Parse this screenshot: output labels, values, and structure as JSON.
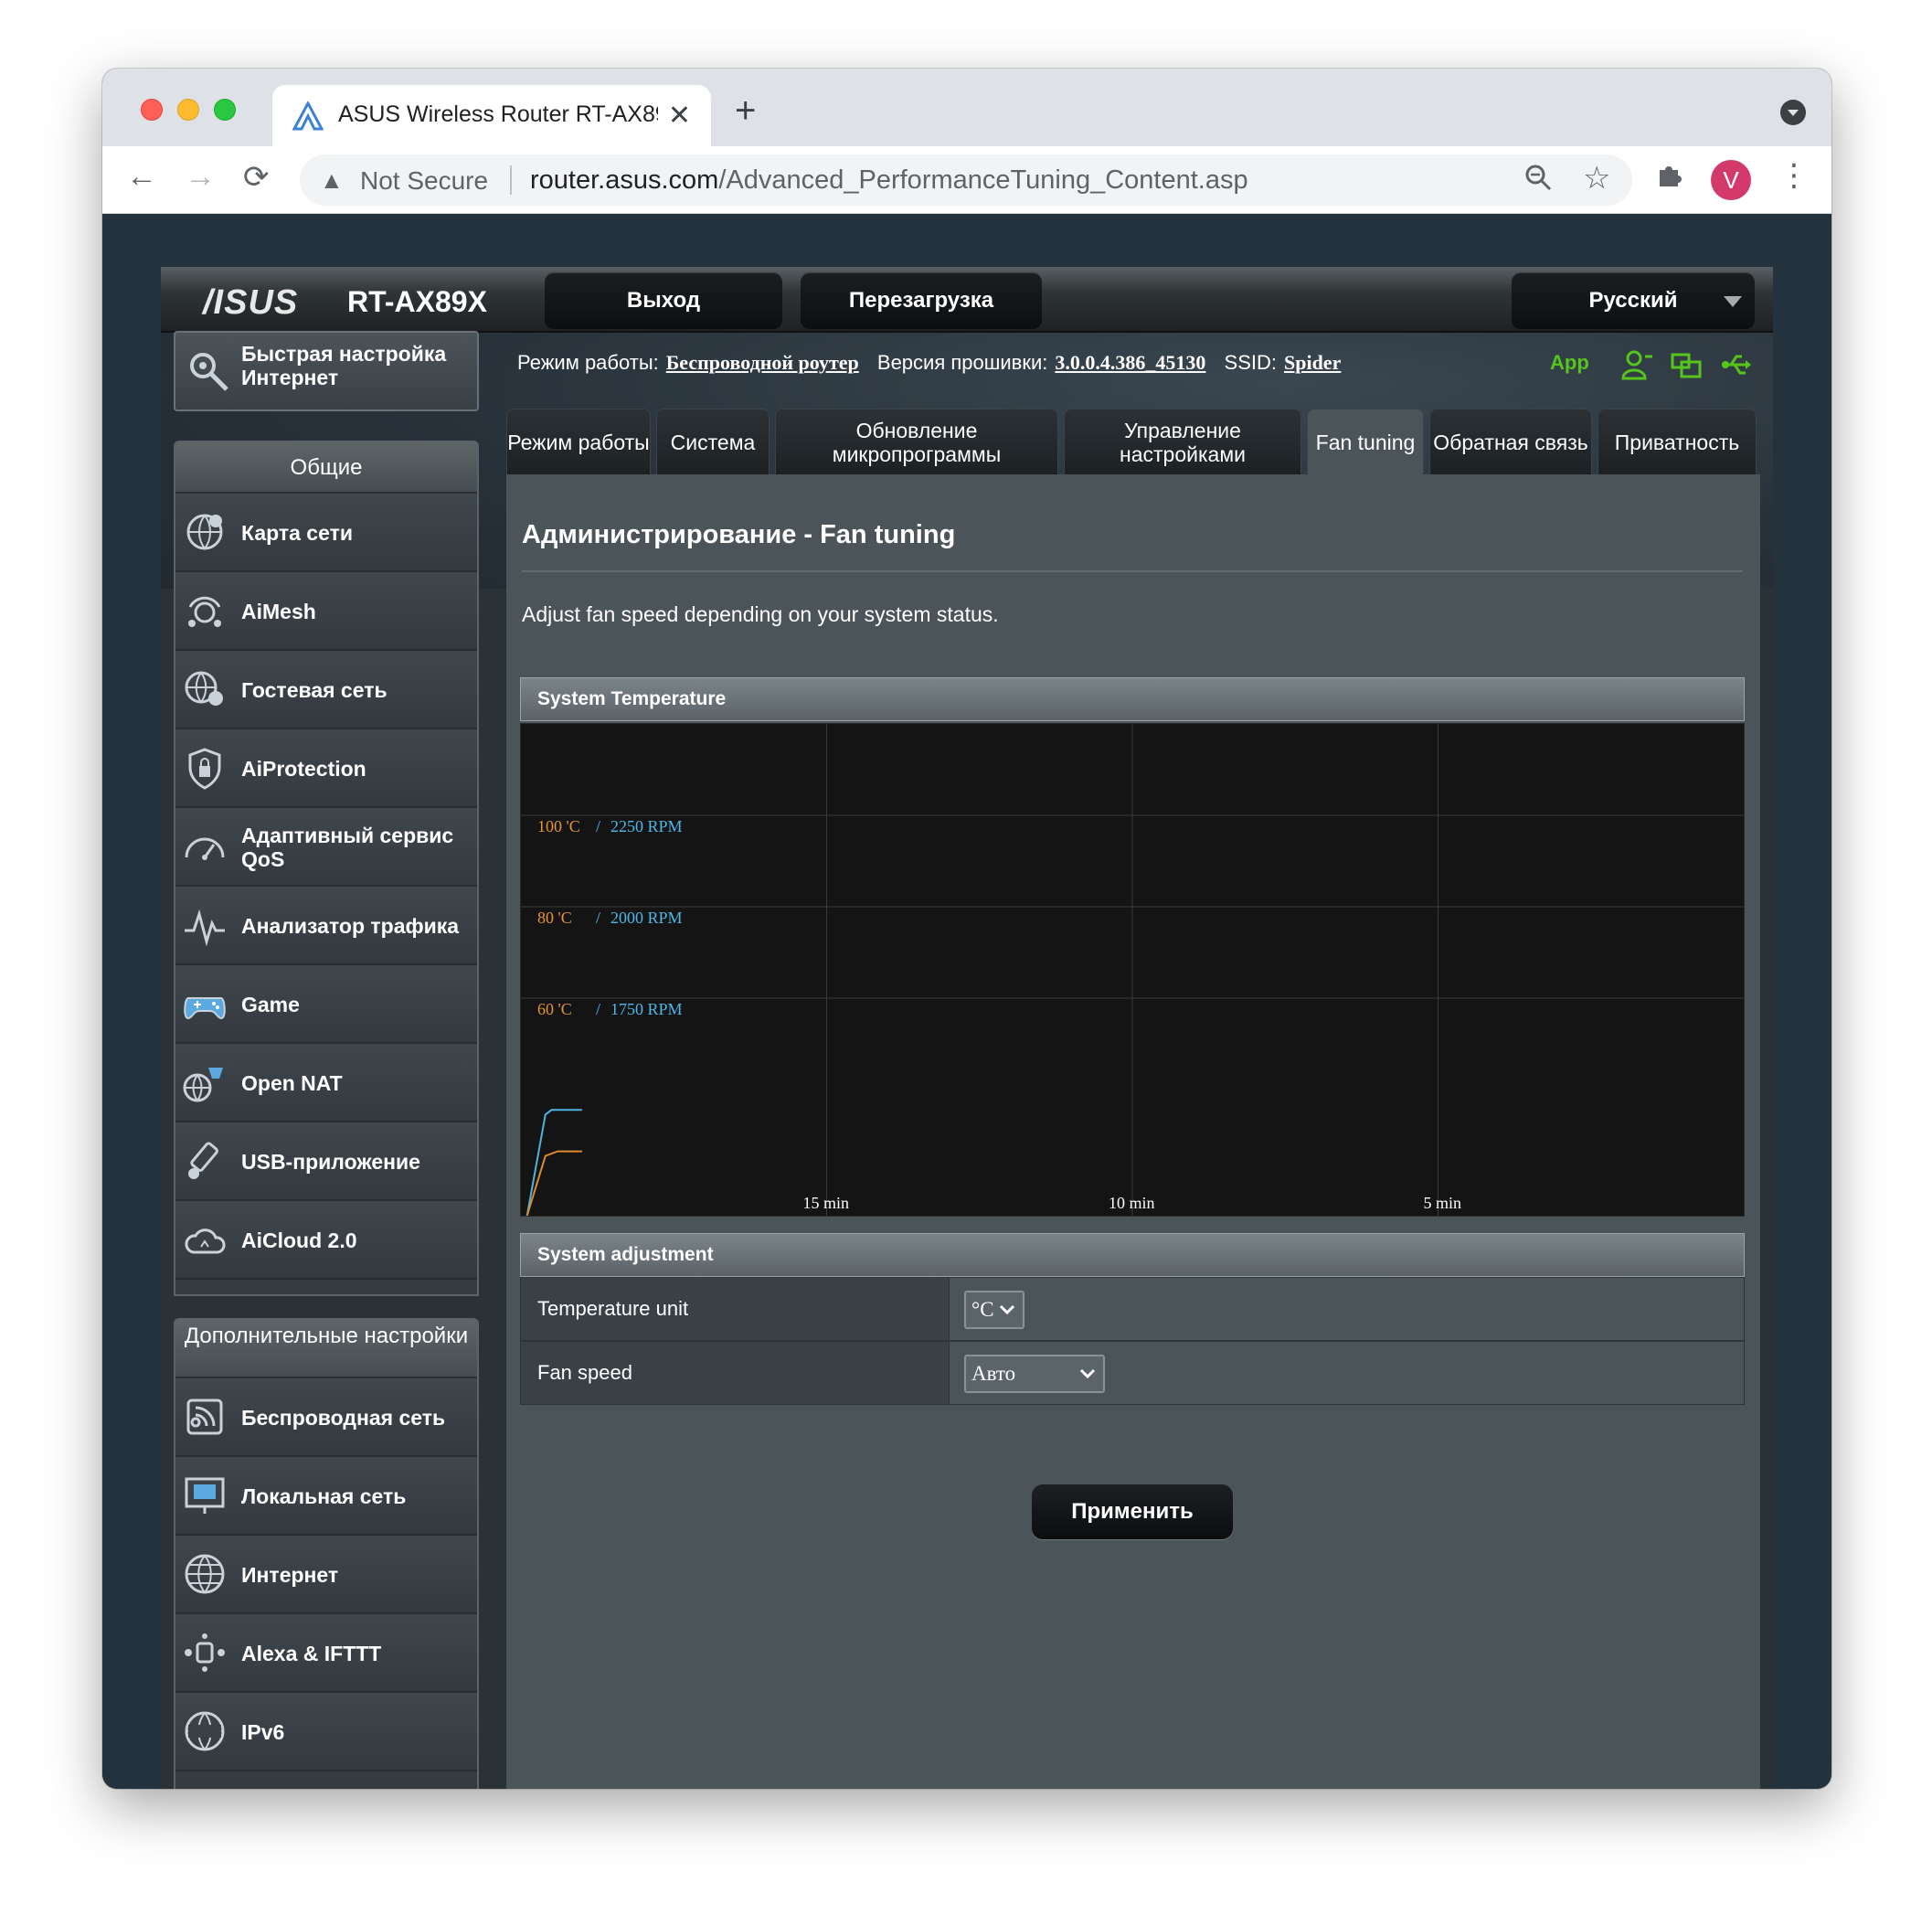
{
  "browser": {
    "tab_title": "ASUS Wireless Router RT-AX89X",
    "tab_close": "✕",
    "new_tab": "+",
    "not_secure": "Not Secure",
    "url_host": "router.asus.com",
    "url_path": "/Advanced_PerformanceTuning_Content.asp",
    "avatar_letter": "V"
  },
  "header": {
    "logo": "/ISUS",
    "model": "RT-AX89X",
    "logout": "Выход",
    "reboot": "Перезагрузка",
    "language": "Русский"
  },
  "infobar": {
    "mode_label": "Режим работы:",
    "mode_value": "Беспроводной роутер",
    "fw_label": "Версия прошивки:",
    "fw_value": "3.0.0.4.386_45130",
    "ssid_label": "SSID:",
    "ssid_value": "Spider",
    "app_label": "App"
  },
  "sidebar": {
    "quick_setup": "Быстрая настройка Интернет",
    "general_title": "Общие",
    "general_items": [
      {
        "label": "Карта сети"
      },
      {
        "label": "AiMesh"
      },
      {
        "label": "Гостевая сеть"
      },
      {
        "label": "AiProtection"
      },
      {
        "label": "Адаптивный сервис QoS"
      },
      {
        "label": "Анализатор трафика"
      },
      {
        "label": "Game"
      },
      {
        "label": "Open NAT"
      },
      {
        "label": "USB-приложение"
      },
      {
        "label": "AiCloud 2.0"
      }
    ],
    "advanced_title": "Дополнительные настройки",
    "advanced_items": [
      {
        "label": "Беспроводная сеть"
      },
      {
        "label": "Локальная сеть"
      },
      {
        "label": "Интернет"
      },
      {
        "label": "Alexa & IFTTT"
      },
      {
        "label": "IPv6"
      }
    ]
  },
  "tabs": [
    {
      "label": "Режим работы"
    },
    {
      "label": "Система"
    },
    {
      "label": "Обновление микропрограммы"
    },
    {
      "label": "Управление настройками"
    },
    {
      "label": "Fan tuning"
    },
    {
      "label": "Обратная связь"
    },
    {
      "label": "Приватность"
    }
  ],
  "main": {
    "title": "Администрирование - Fan tuning",
    "description": "Adjust fan speed depending on your system status.",
    "temp_section": "System Temperature",
    "adjust_section": "System adjustment",
    "temp_unit_label": "Temperature unit",
    "temp_unit_value": "°C",
    "fan_speed_label": "Fan speed",
    "fan_speed_value": "Авто",
    "apply": "Применить"
  },
  "chart_data": {
    "type": "line",
    "y_labels": [
      {
        "temp": "100 'C",
        "rpm": "2250 RPM"
      },
      {
        "temp": "80 'C",
        "rpm": "2000 RPM"
      },
      {
        "temp": "60 'C",
        "rpm": "1750 RPM"
      }
    ],
    "x_labels": [
      "15 min",
      "10 min",
      "5 min"
    ],
    "series": [
      {
        "color": "#4fb3e0",
        "points": [
          [
            19.9,
            1500
          ],
          [
            19.6,
            1720
          ],
          [
            19.5,
            1730
          ],
          [
            19.1,
            1730
          ],
          [
            19.0,
            1730
          ]
        ]
      },
      {
        "color": "#e08a2c",
        "points": [
          [
            19.9,
            1500
          ],
          [
            19.6,
            1630
          ],
          [
            19.4,
            1640
          ],
          [
            19.0,
            1640
          ]
        ]
      }
    ],
    "y_range": [
      1500,
      2500
    ],
    "x_range": [
      20,
      0
    ],
    "colors": {
      "temp_label": "#e7923a",
      "rpm_label": "#4fb7e6",
      "grid": "#3a3a3a"
    }
  }
}
